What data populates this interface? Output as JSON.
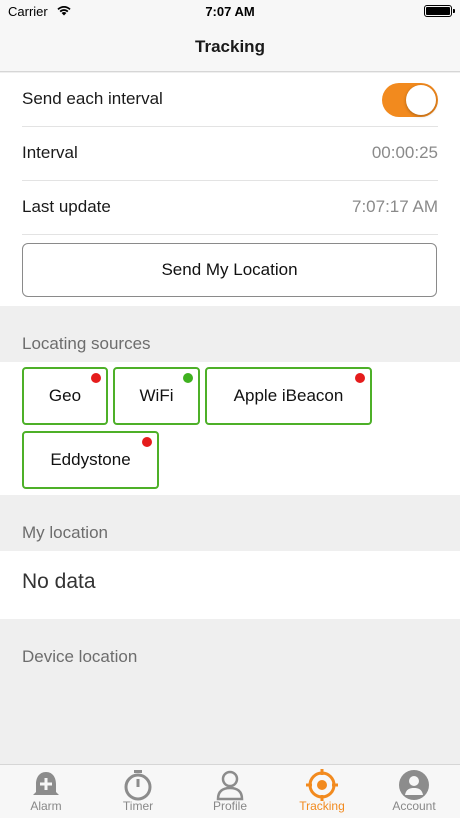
{
  "status_bar": {
    "carrier": "Carrier",
    "time": "7:07 AM"
  },
  "nav": {
    "title": "Tracking"
  },
  "settings": {
    "send_each_interval": {
      "label": "Send each interval",
      "enabled": true
    },
    "interval": {
      "label": "Interval",
      "value": "00:00:25"
    },
    "last_update": {
      "label": "Last update",
      "value": "7:07:17 AM"
    }
  },
  "send_button": {
    "label": "Send My Location"
  },
  "locating_sources": {
    "header": "Locating sources",
    "items": [
      {
        "label": "Geo",
        "status_color": "#e51c1c"
      },
      {
        "label": "WiFi",
        "status_color": "#3fb11f"
      },
      {
        "label": "Apple iBeacon",
        "status_color": "#e51c1c"
      },
      {
        "label": "Eddystone",
        "status_color": "#e51c1c"
      }
    ]
  },
  "my_location": {
    "header": "My location",
    "value": "No data"
  },
  "device_location": {
    "header": "Device location"
  },
  "tab_bar": {
    "items": [
      {
        "label": "Alarm",
        "icon": "alarm-bell-icon",
        "active": false
      },
      {
        "label": "Timer",
        "icon": "stopwatch-icon",
        "active": false
      },
      {
        "label": "Profile",
        "icon": "person-icon",
        "active": false
      },
      {
        "label": "Tracking",
        "icon": "target-icon",
        "active": true
      },
      {
        "label": "Account",
        "icon": "account-circle-icon",
        "active": false
      }
    ]
  },
  "colors": {
    "accent": "#f28a1e",
    "chip_border": "#4db028",
    "status_off": "#e51c1c",
    "status_on": "#3fb11f"
  }
}
